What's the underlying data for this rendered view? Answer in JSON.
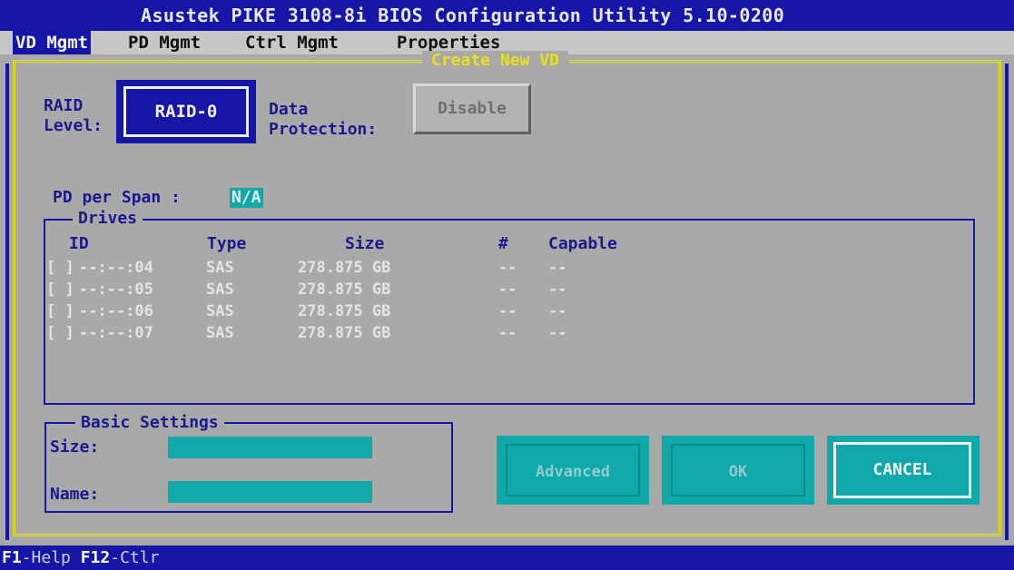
{
  "window": {
    "title": "Asustek PIKE 3108-8i BIOS Configuration Utility 5.10-0200"
  },
  "menu": [
    {
      "label": "VD Mgmt",
      "active": true
    },
    {
      "label": "PD Mgmt",
      "active": false
    },
    {
      "label": "Ctrl Mgmt",
      "active": false
    },
    {
      "label": "Properties",
      "active": false
    }
  ],
  "dialog": {
    "title": "Create New VD",
    "raid_level": {
      "label_line1": "RAID",
      "label_line2": "Level:",
      "value": "RAID-0"
    },
    "data_protection": {
      "label_line1": "Data",
      "label_line2": "Protection:",
      "value": "Disable"
    },
    "pd_per_span": {
      "label": "PD per Span :",
      "value": "N/A"
    },
    "drives": {
      "legend": "Drives",
      "columns": {
        "id": "ID",
        "type": "Type",
        "size": "Size",
        "num": "#",
        "capable": "Capable"
      },
      "rows": [
        {
          "check": "[ ]",
          "id": "--:--:04",
          "type": "SAS",
          "size": "278.875 GB",
          "num": "--",
          "capable": "--"
        },
        {
          "check": "[ ]",
          "id": "--:--:05",
          "type": "SAS",
          "size": "278.875 GB",
          "num": "--",
          "capable": "--"
        },
        {
          "check": "[ ]",
          "id": "--:--:06",
          "type": "SAS",
          "size": "278.875 GB",
          "num": "--",
          "capable": "--"
        },
        {
          "check": "[ ]",
          "id": "--:--:07",
          "type": "SAS",
          "size": "278.875 GB",
          "num": "--",
          "capable": "--"
        }
      ]
    },
    "basic_settings": {
      "legend": "Basic Settings",
      "size_label": "Size:",
      "size_value": "",
      "name_label": "Name:",
      "name_value": ""
    },
    "buttons": {
      "advanced": "Advanced",
      "ok": "OK",
      "cancel": "CANCEL"
    }
  },
  "status_bar": {
    "help_key": "F1",
    "help_label": "-Help",
    "ctrl_key": "F12",
    "ctrl_label": "-Ctlr"
  },
  "colors": {
    "bios_blue": "#1616a6",
    "panel_gray": "#a9a9a9",
    "highlight_cyan": "#10a8a8",
    "frame_yellow": "#e8e020"
  }
}
